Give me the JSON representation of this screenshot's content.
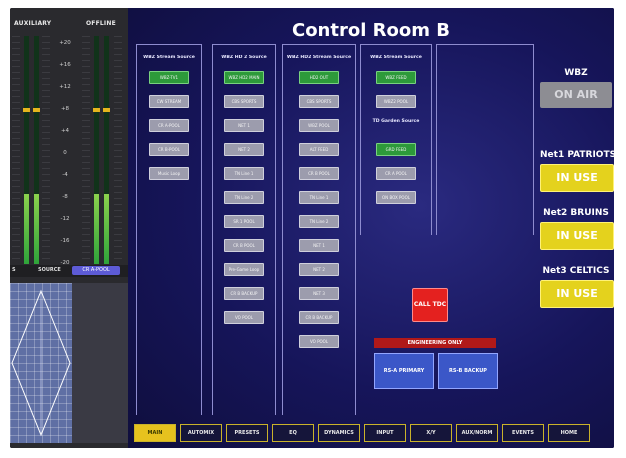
{
  "window": {
    "title": "Control Room B"
  },
  "meters": {
    "left_title": "AUXILIARY",
    "right_title": "OFFLINE",
    "scale": [
      "+20",
      "+16",
      "+12",
      "+8",
      "+4",
      "0",
      "-4",
      "-8",
      "-12",
      "-16",
      "-20"
    ],
    "source_label": "SOURCE",
    "source_value": "CR A-POOL",
    "left_label_prefix": "S"
  },
  "columns": [
    {
      "header": "WBZ Stream Source",
      "buttons": [
        {
          "label": "WBZ-TV1",
          "state": "on"
        },
        {
          "label": "CW STREAM",
          "state": "off"
        },
        {
          "label": "CR A-POOL",
          "state": "off"
        },
        {
          "label": "CR B-POOL",
          "state": "off"
        },
        {
          "label": "Music Loop",
          "state": "off"
        }
      ]
    },
    {
      "header": "WBZ HD 2 Source",
      "buttons": [
        {
          "label": "WBZ HD2 MAIN",
          "state": "on"
        },
        {
          "label": "CBS SPORTS",
          "state": "off"
        },
        {
          "label": "NET 1",
          "state": "off"
        },
        {
          "label": "NET 2",
          "state": "off"
        },
        {
          "label": "TN Line 1",
          "state": "off"
        },
        {
          "label": "TN Line 2",
          "state": "off"
        },
        {
          "label": "SR 1 POOL",
          "state": "off"
        },
        {
          "label": "CR B POOL",
          "state": "off"
        },
        {
          "label": "Pre-Game Loop",
          "state": "off"
        },
        {
          "label": "CR B BACKUP",
          "state": "off"
        },
        {
          "label": "VO POOL",
          "state": "off"
        }
      ]
    },
    {
      "header": "WBZ HD2 Stream Source",
      "buttons": [
        {
          "label": "HD2 OUT",
          "state": "on"
        },
        {
          "label": "CBS SPORTS",
          "state": "off"
        },
        {
          "label": "WBZ POOL",
          "state": "off"
        },
        {
          "label": "ALT FEED",
          "state": "off"
        },
        {
          "label": "CR B POOL",
          "state": "off"
        },
        {
          "label": "TN Line 1",
          "state": "off"
        },
        {
          "label": "TN Line 2",
          "state": "off"
        },
        {
          "label": "NET 1",
          "state": "off"
        },
        {
          "label": "NET 2",
          "state": "off"
        },
        {
          "label": "NET 3",
          "state": "off"
        },
        {
          "label": "CR B BACKUP",
          "state": "off"
        },
        {
          "label": "VO POOL",
          "state": "off"
        }
      ]
    },
    {
      "header": "WBZ Stream Source",
      "buttons": [
        {
          "label": "WBZ FEED",
          "state": "on"
        },
        {
          "label": "WBZ2 POOL",
          "state": "off"
        }
      ],
      "subheader": "TD Garden Source",
      "sub_buttons": [
        {
          "label": "GRD FEED",
          "state": "on"
        },
        {
          "label": "CR A POOL",
          "state": "off"
        },
        {
          "label": "ON BOX POOL",
          "state": "off"
        }
      ]
    }
  ],
  "center": {
    "call_tdc": "CALL TDC",
    "engineering_only": "ENGINEERING ONLY",
    "primary": "RS-A PRIMARY",
    "backup": "RS-B BACKUP"
  },
  "status": {
    "wbz_label": "WBZ",
    "wbz_value": "ON AIR",
    "net1_label": "Net1 PATRIOTS",
    "net1_value": "IN USE",
    "net2_label": "Net2 BRUINS",
    "net2_value": "IN USE",
    "net3_label": "Net3 CELTICS",
    "net3_value": "IN USE"
  },
  "nav": [
    {
      "label": "MAIN",
      "active": true
    },
    {
      "label": "AUTOMIX",
      "active": false
    },
    {
      "label": "PRESETS",
      "active": false
    },
    {
      "label": "EQ",
      "active": false
    },
    {
      "label": "DYNAMICS",
      "active": false
    },
    {
      "label": "INPUT",
      "active": false
    },
    {
      "label": "X/Y",
      "active": false
    },
    {
      "label": "AUX/NORM",
      "active": false
    },
    {
      "label": "EVENTS",
      "active": false
    },
    {
      "label": "HOME",
      "active": false
    }
  ],
  "colors": {
    "background": "#13124a",
    "accent_green": "#2d9a3a",
    "accent_yellow": "#e4d21d",
    "accent_red": "#e4211f",
    "accent_blue": "#3b57c8"
  }
}
